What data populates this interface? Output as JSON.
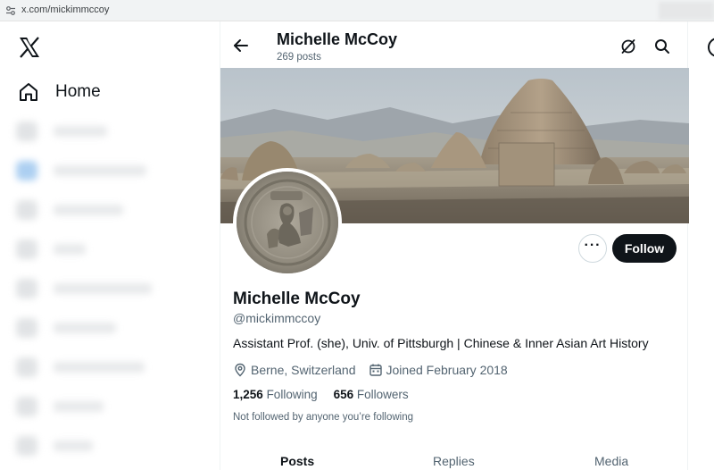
{
  "browser": {
    "url": "x.com/mickimmccoy"
  },
  "sidebar": {
    "home_label": "Home"
  },
  "header": {
    "name": "Michelle McCoy",
    "posts_count": "269 posts"
  },
  "profile": {
    "name": "Michelle McCoy",
    "handle": "@mickimmccoy",
    "bio": "Assistant Prof. (she), Univ. of Pittsburgh | Chinese & Inner Asian Art History",
    "location": "Berne, Switzerland",
    "joined": "Joined February 2018",
    "following_count": "1,256",
    "following_label": "Following",
    "followers_count": "656",
    "followers_label": "Followers",
    "followed_by_note": "Not followed by anyone you’re following",
    "follow_button_label": "Follow",
    "more_button_label": "···"
  },
  "tabs": [
    {
      "label": "Posts",
      "active": true
    },
    {
      "label": "Replies",
      "active": false
    },
    {
      "label": "Media",
      "active": false
    }
  ],
  "icons": {
    "x_logo": "x-logo-icon",
    "home": "home-icon",
    "back": "arrow-left-icon",
    "grok": "grok-icon",
    "search": "search-icon",
    "location": "location-pin-icon",
    "calendar": "calendar-icon"
  },
  "colors": {
    "text_primary": "#0f1419",
    "text_secondary": "#536471",
    "follow_button": "#0f1419"
  }
}
